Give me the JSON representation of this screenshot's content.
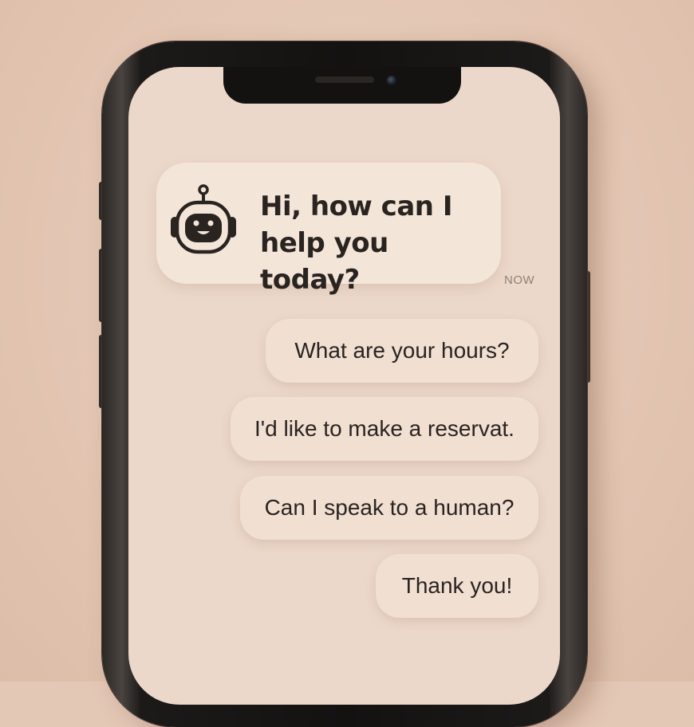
{
  "chat": {
    "bot_message": {
      "line1": "Hi, how can I",
      "line2": "help you today?",
      "avatar_icon": "robot-icon",
      "timestamp": "NOW"
    },
    "quick_replies": [
      {
        "label": "What are your hours?"
      },
      {
        "label": "I'd like to make a reservat."
      },
      {
        "label": "Can I speak to a human?"
      },
      {
        "label": "Thank you!"
      }
    ]
  },
  "colors": {
    "background": "#e4c8b6",
    "screen": "#ecd8ca",
    "bubble": "#f4e5d9",
    "text": "#2a2421",
    "timestamp": "#8e8079"
  }
}
